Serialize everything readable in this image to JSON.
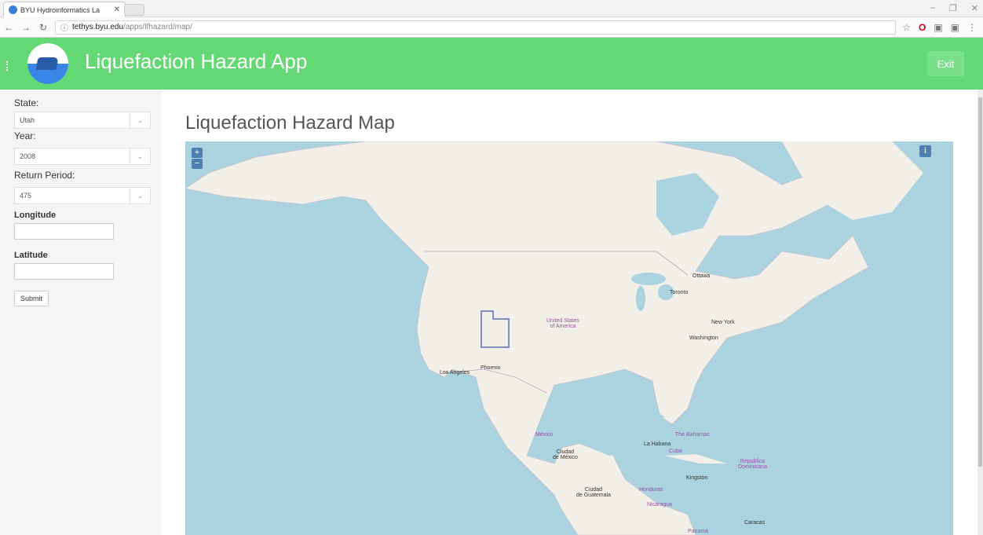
{
  "browser": {
    "tab_title": "BYU Hydroinformatics La",
    "url_host": "tethys.byu.edu",
    "url_path": "/apps/lfhazard/map/"
  },
  "header": {
    "app_title": "Liquefaction Hazard App",
    "exit_label": "Exit"
  },
  "sidebar": {
    "state_label": "State:",
    "state_value": "Utah",
    "year_label": "Year:",
    "year_value": "2008",
    "return_period_label": "Return Period:",
    "return_period_value": "475",
    "longitude_label": "Longitude",
    "longitude_value": "",
    "latitude_label": "Latitude",
    "latitude_value": "",
    "submit_label": "Submit"
  },
  "main": {
    "map_title": "Liquefaction Hazard Map",
    "zoom_in": "+",
    "zoom_out": "−",
    "info": "i"
  },
  "map_labels": {
    "ottawa": "Ottawa",
    "toronto": "Toronto",
    "new_york": "New York",
    "washington": "Washington",
    "usa": "United States\nof America",
    "los_angeles": "Los Angeles",
    "phoenix": "Phoenix",
    "mexico": "México",
    "ciudad_mexico": "Ciudad\nde México",
    "la_habana": "La Habana",
    "bahamas": "The Bahamas",
    "cuba": "Cuba",
    "republica_dominicana": "República\nDominicana",
    "kingston": "Kingston",
    "ciudad_guatemala": "Ciudad\nde Guatemala",
    "honduras": "Honduras",
    "nicaragua": "Nicaragua",
    "caracas": "Caracas",
    "panama": "Panamá"
  }
}
